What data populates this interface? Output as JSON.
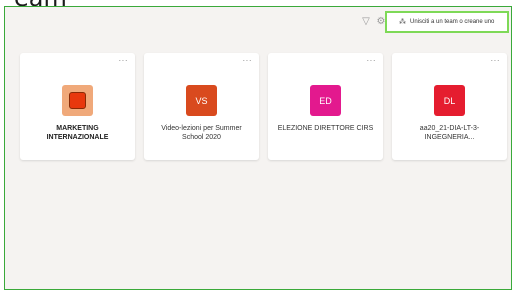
{
  "top_clipped_text": "eam",
  "toolbar": {
    "join_label": "Unisciti a un team o creane uno"
  },
  "teams": [
    {
      "initials": "",
      "name": "MARKETING INTERNAZIONALE",
      "color": "#f0a97a"
    },
    {
      "initials": "VS",
      "name": "Video-lezioni per Summer School 2020",
      "color": "#d94a1e"
    },
    {
      "initials": "ED",
      "name": "ELEZIONE DIRETTORE CIRS",
      "color": "#e3198e"
    },
    {
      "initials": "DL",
      "name": "aa20_21-DIA-LT-3-INGEGNERIA...",
      "color": "#e51d2f"
    }
  ],
  "more_label": "···"
}
